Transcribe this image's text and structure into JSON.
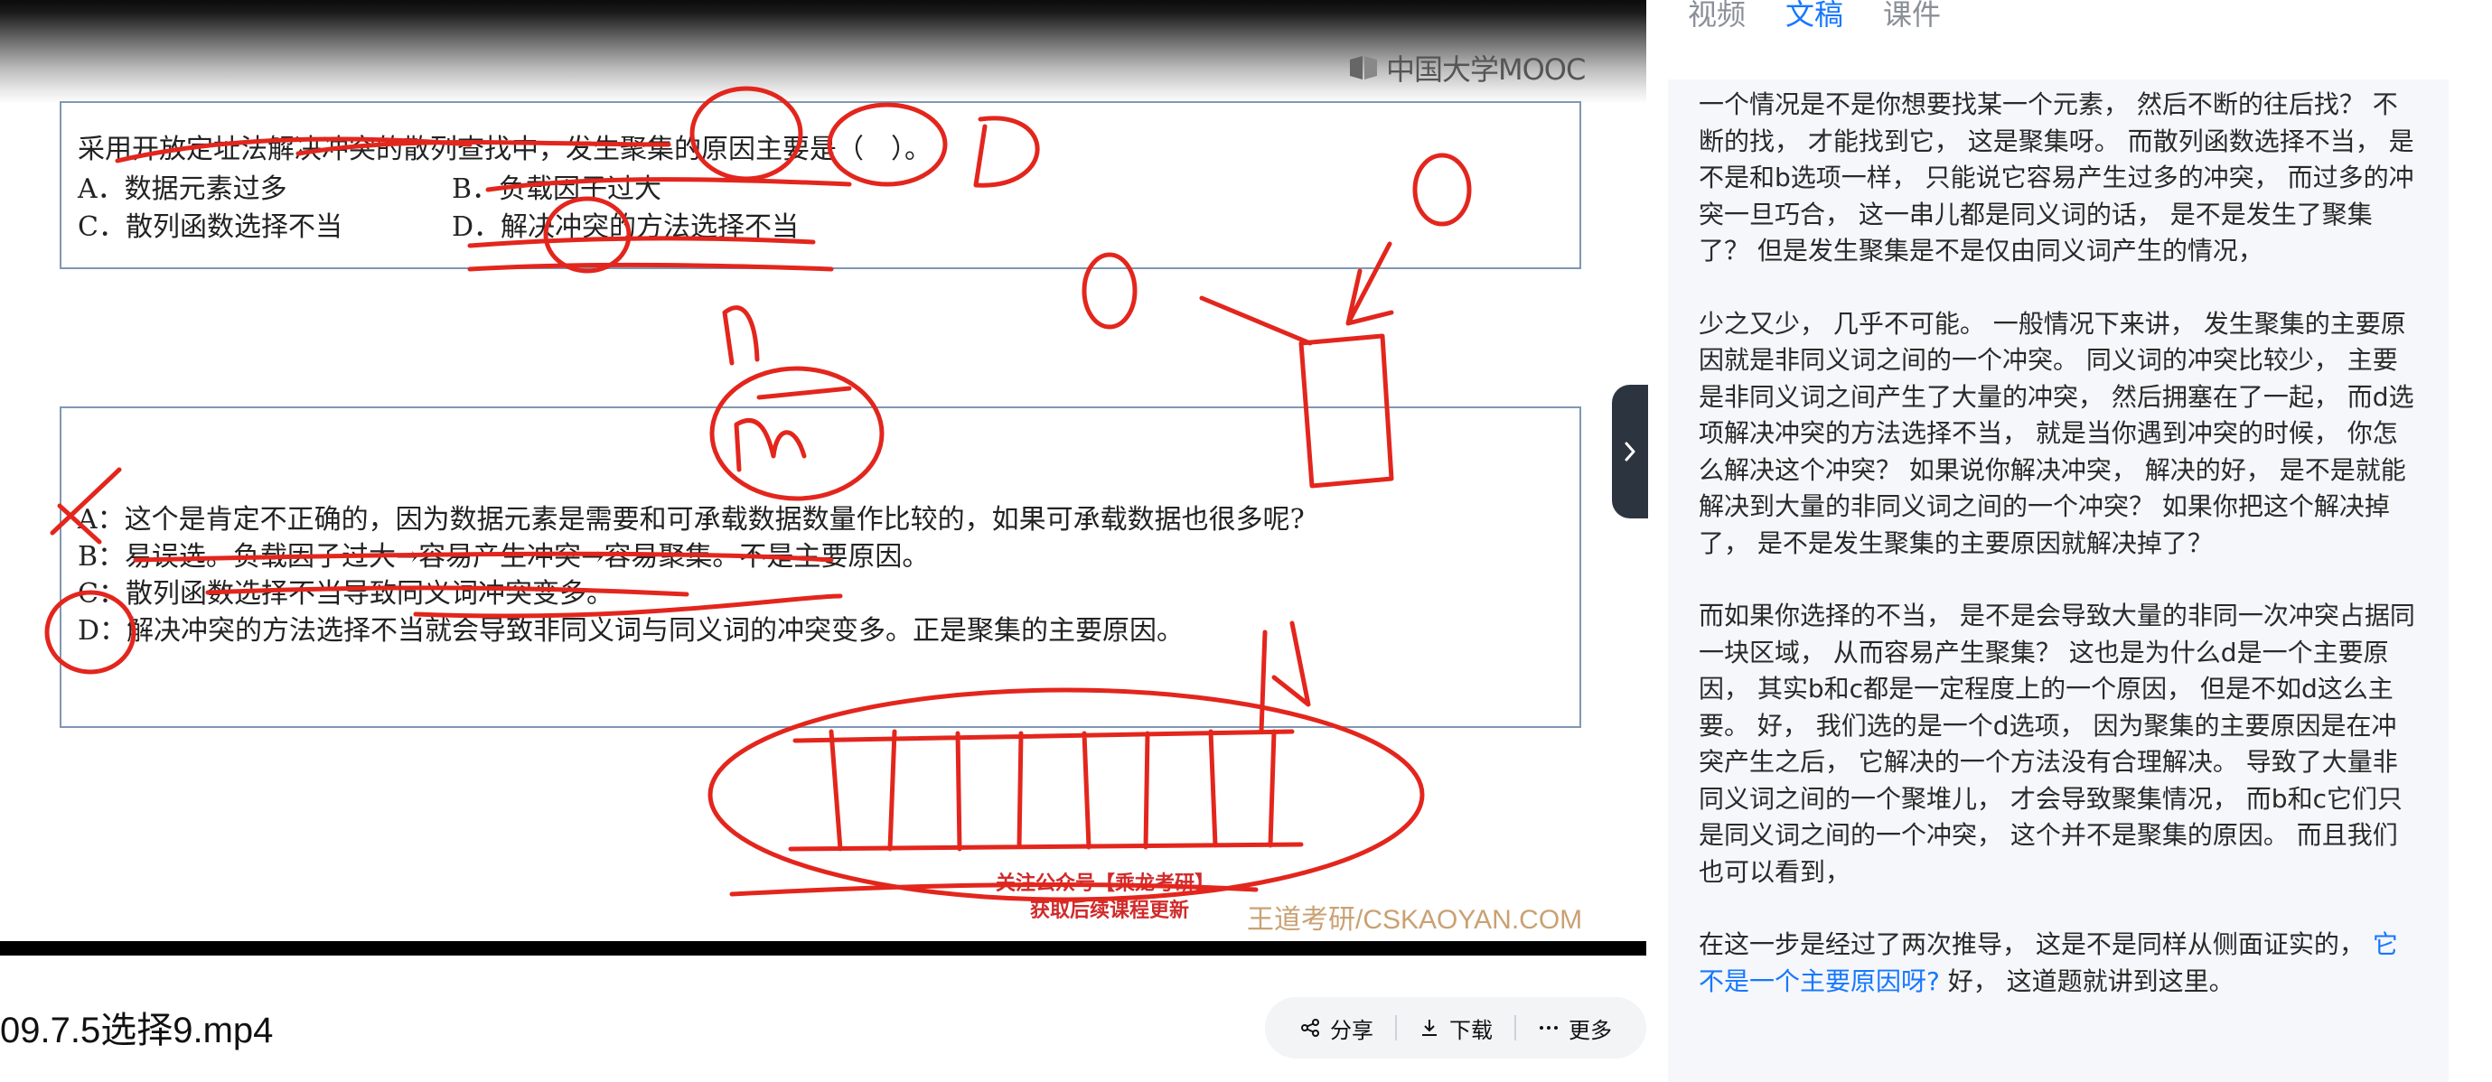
{
  "video": {
    "logo_text": "中国大学MOOC",
    "question": {
      "stem": "采用开放定址法解决冲突的散列查找中，发生聚集的原因主要是（　）。",
      "options": [
        "A．数据元素过多",
        "B．负载因子过大",
        "C．散列函数选择不当",
        "D．解决冲突的方法选择不当"
      ]
    },
    "answer_lines": [
      "A：这个是肯定不正确的，因为数据元素是需要和可承载数据数量作比较的，如果可承载数据也很多呢?",
      "B：易误选。负载因子过大→容易产生冲突→容易聚集。不是主要原因。",
      "C：散列函数选择不当导致同义词冲突变多。",
      "D：解决冲突的方法选择不当就会导致非同义词与同义词的冲突变多。正是聚集的主要原因。"
    ],
    "watermark_follow_1": "关注公众号【乘龙考研】",
    "watermark_follow_2": "获取后续课程更新",
    "watermark_site": "王道考研/CSKAOYAN.COM",
    "annotation_color": "#e3261d"
  },
  "title": "09.7.5选择9.mp4",
  "actions": {
    "share": "分享",
    "download": "下载",
    "more": "更多"
  },
  "tabs": [
    {
      "label": "视频",
      "active": false
    },
    {
      "label": "文稿",
      "active": true
    },
    {
      "label": "课件",
      "active": false
    }
  ],
  "transcript": {
    "p1": "一个情况是不是你想要找某一个元素， 然后不断的往后找？ 不断的找， 才能找到它， 这是聚集呀。 而散列函数选择不当， 是不是和b选项一样， 只能说它容易产生过多的冲突， 而过多的冲突一旦巧合， 这一串儿都是同义词的话， 是不是发生了聚集了？ 但是发生聚集是不是仅由同义词产生的情况，",
    "p2": "少之又少， 几乎不可能。 一般情况下来讲， 发生聚集的主要原因就是非同义词之间的一个冲突。 同义词的冲突比较少， 主要是非同义词之间产生了大量的冲突， 然后拥塞在了一起， 而d选项解决冲突的方法选择不当， 就是当你遇到冲突的时候， 你怎么解决这个冲突？ 如果说你解决冲突， 解决的好， 是不是就能解决到大量的非同义词之间的一个冲突？ 如果你把这个解决掉了， 是不是发生聚集的主要原因就解决掉了？",
    "p3": "而如果你选择的不当， 是不是会导致大量的非同一次冲突占据同一块区域， 从而容易产生聚集？ 这也是为什么d是一个主要原因， 其实b和c都是一定程度上的一个原因， 但是不如d这么主要。 好， 我们选的是一个d选项， 因为聚集的主要原因是在冲突产生之后， 它解决的一个方法没有合理解决。 导致了大量非同义词之间的一个聚堆儿， 才会导致聚集情况， 而b和c它们只是同义词之间的一个冲突， 这个并不是聚集的原因。 而且我们也可以看到，",
    "p4_pre": "在这一步是经过了两次推导， 这是不是同样从侧面证实的， ",
    "p4_highlight": "它不是一个主要原因呀?",
    "p4_post": " 好， 这道题就讲到这里。"
  },
  "colors": {
    "accent": "#1677ff",
    "toggle_bg": "#2c3440",
    "panel_bg": "#f5f7fa"
  }
}
